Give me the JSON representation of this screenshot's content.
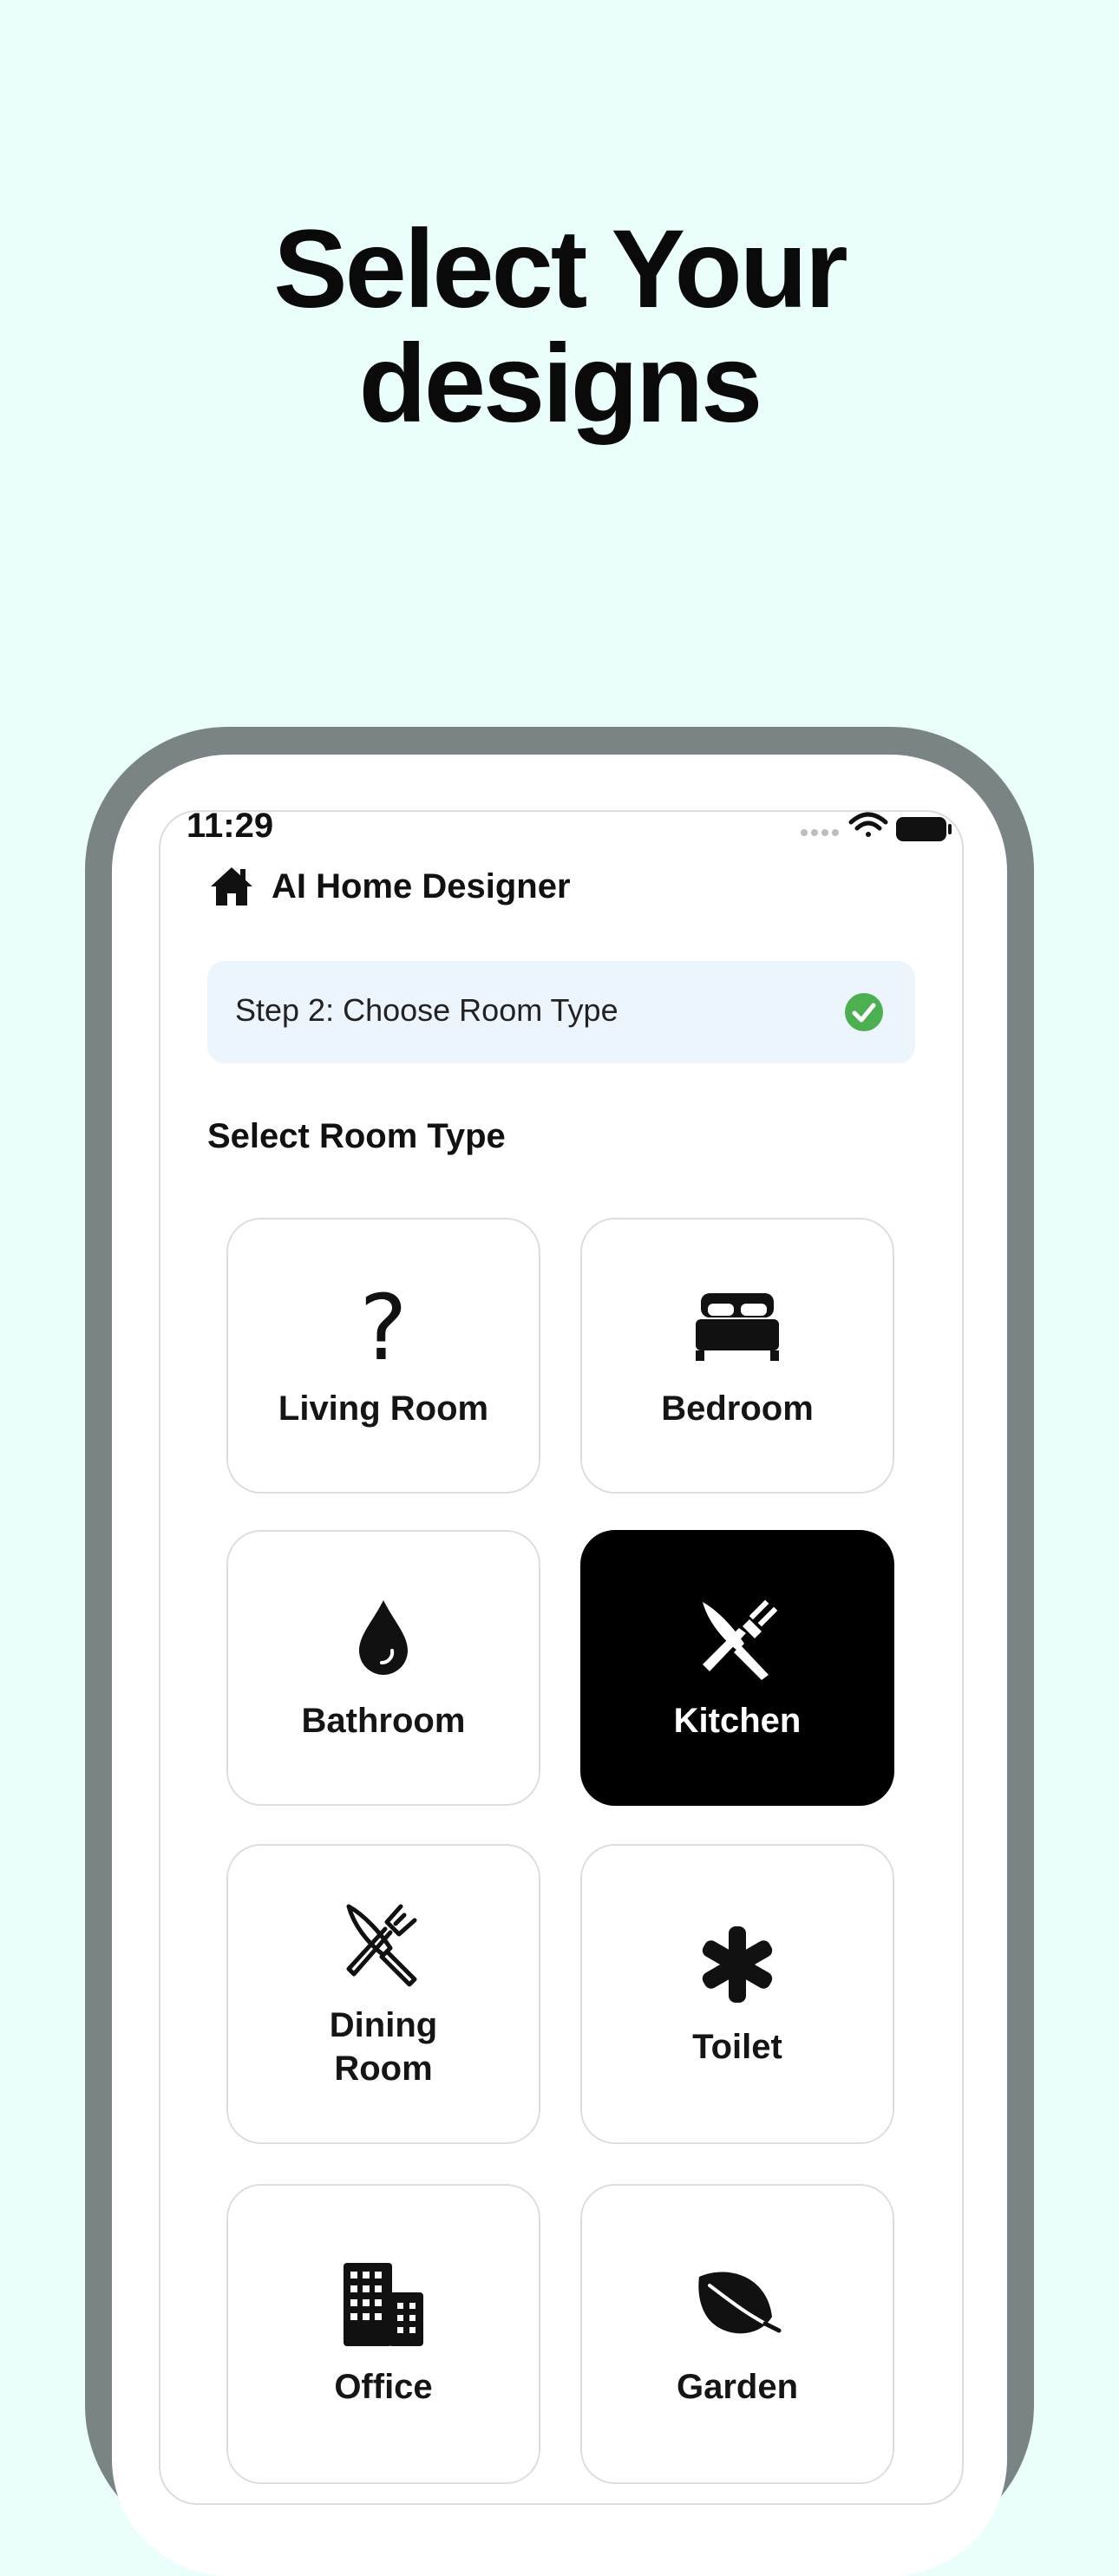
{
  "headline": {
    "line1": "Select Your",
    "line2": "designs"
  },
  "status_bar": {
    "time": "11:29"
  },
  "app": {
    "title": "AI Home Designer",
    "icon": "house-icon"
  },
  "step_banner": {
    "text": "Step 2: Choose Room Type",
    "check_color": "#4CAF50"
  },
  "section": {
    "title": "Select Room Type"
  },
  "room_types": [
    {
      "label": "Living Room",
      "icon": "question-mark-icon",
      "selected": false
    },
    {
      "label": "Bedroom",
      "icon": "bed-icon",
      "selected": false
    },
    {
      "label": "Bathroom",
      "icon": "drop-icon",
      "selected": false
    },
    {
      "label": "Kitchen",
      "icon": "fork-knife-icon",
      "selected": true
    },
    {
      "label": "Dining\nRoom",
      "icon": "fork-knife-outline-icon",
      "selected": false
    },
    {
      "label": "Toilet",
      "icon": "asterisk-icon",
      "selected": false
    },
    {
      "label": "Office",
      "icon": "building-icon",
      "selected": false
    },
    {
      "label": "Garden",
      "icon": "leaf-icon",
      "selected": false
    }
  ],
  "colors": {
    "background": "#EAFEFC",
    "selected_card": "#000000",
    "banner": "#EDF5FC"
  }
}
